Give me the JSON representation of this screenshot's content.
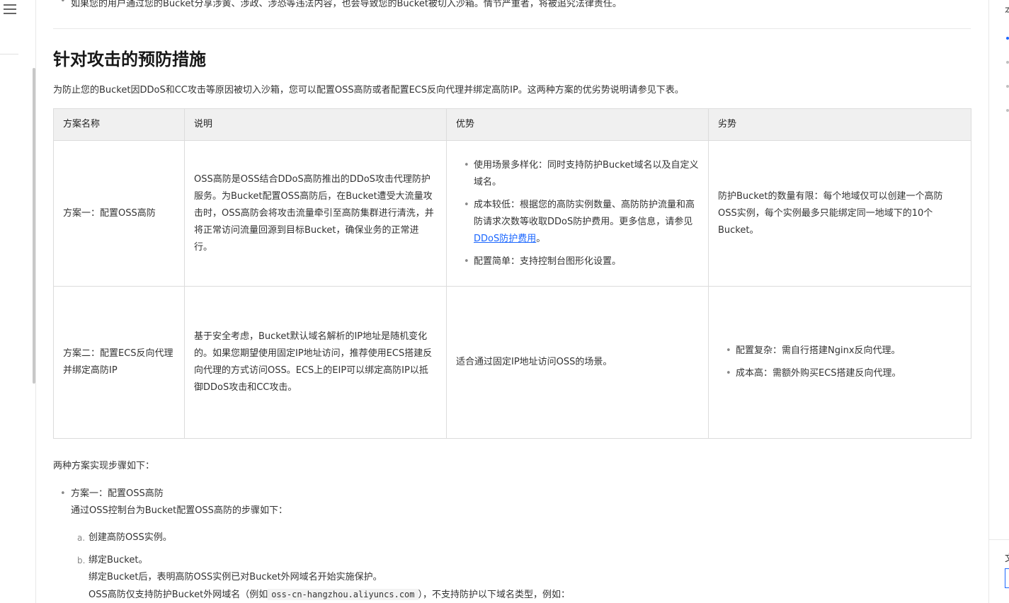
{
  "top_bullet": "如果您的用户通过您的Bucket分享涉黄、涉政、涉恐等违法内容，也会导致您的Bucket被切入沙箱。情节严重者，将被追究法律责任。",
  "section": {
    "heading": "针对攻击的预防措施",
    "intro": "为防止您的Bucket因DDoS和CC攻击等原因被切入沙箱，您可以配置OSS高防或者配置ECS反向代理并绑定高防IP。这两种方案的优劣势说明请参见下表。"
  },
  "table": {
    "headers": [
      "方案名称",
      "说明",
      "优势",
      "劣势"
    ],
    "row1": {
      "name": "方案一：配置OSS高防",
      "desc": "OSS高防是OSS结合DDoS高防推出的DDoS攻击代理防护服务。为Bucket配置OSS高防后，在Bucket遭受大流量攻击时，OSS高防会将攻击流量牵引至高防集群进行清洗，并将正常访问流量回源到目标Bucket，确保业务的正常进行。",
      "pro1": "使用场景多样化：同时支持防护Bucket域名以及自定义域名。",
      "pro2_text": "成本较低：根据您的高防实例数量、高防防护流量和高防请求次数等收取DDoS防护费用。更多信息，请参见",
      "pro2_link": "DDoS防护费用",
      "pro2_end": "。",
      "pro3": "配置简单：支持控制台图形化设置。",
      "con": "防护Bucket的数量有限：每个地域仅可以创建一个高防OSS实例，每个实例最多只能绑定同一地域下的10个Bucket。"
    },
    "row2": {
      "name": "方案二：配置ECS反向代理并绑定高防IP",
      "desc": "基于安全考虑，Bucket默认域名解析的IP地址是随机变化的。如果您期望使用固定IP地址访问，推荐使用ECS搭建反向代理的方式访问OSS。ECS上的EIP可以绑定高防IP以抵御DDoS攻击和CC攻击。",
      "pro": "适合通过固定IP地址访问OSS的场景。",
      "con1": "配置复杂：需自行搭建Nginx反向代理。",
      "con2": "成本高：需额外购买ECS搭建反向代理。"
    }
  },
  "steps": {
    "intro": "两种方案实现步骤如下：",
    "plan1_title": "方案一：配置OSS高防",
    "plan1_desc": "通过OSS控制台为Bucket配置OSS高防的步骤如下：",
    "sub_a_marker": "a.",
    "sub_a": "创建高防OSS实例。",
    "sub_b_marker": "b.",
    "sub_b": "绑定Bucket。",
    "sub_b_line2": "绑定Bucket后，表明高防OSS实例已对Bucket外网域名开始实施保护。",
    "sub_b_line3_pre": "OSS高防仅支持防护Bucket外网域名（例如",
    "sub_b_code": "oss-cn-hangzhou.aliyuncs.com",
    "sub_b_line3_post": "），不支持防护以下域名类型，例如："
  },
  "toc": {
    "title": "本"
  },
  "right_footer": {
    "text": "文"
  },
  "colors": {
    "link": "#1a66ff",
    "header_bg": "#f0f0f0",
    "border": "#dcdcdc"
  }
}
